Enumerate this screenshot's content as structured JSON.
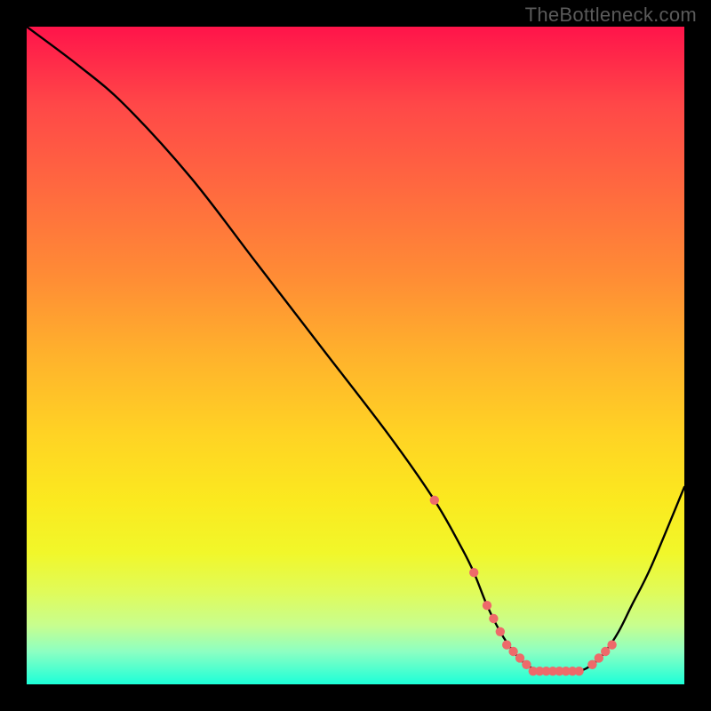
{
  "watermark": "TheBottleneck.com",
  "chart_data": {
    "type": "line",
    "title": "",
    "xlabel": "",
    "ylabel": "",
    "xlim": [
      0,
      100
    ],
    "ylim": [
      0,
      100
    ],
    "series": [
      {
        "name": "curve",
        "x": [
          0,
          8,
          15,
          25,
          35,
          45,
          55,
          62,
          66,
          68,
          70,
          72,
          74,
          76,
          78,
          80,
          82,
          84,
          86,
          88,
          90,
          92,
          95,
          100
        ],
        "y": [
          100,
          94,
          88,
          77,
          64,
          51,
          38,
          28,
          21,
          17,
          12,
          8,
          5,
          3,
          2,
          2,
          2,
          2,
          3,
          5,
          8,
          12,
          18,
          30
        ]
      }
    ],
    "markers": {
      "name": "highlight-points",
      "color": "#ee6a6a",
      "x": [
        62,
        68,
        70,
        71,
        72,
        73,
        74,
        75,
        76,
        77,
        78,
        79,
        80,
        81,
        82,
        83,
        84,
        86,
        87,
        88,
        89
      ],
      "y": [
        28,
        17,
        12,
        10,
        8,
        6,
        5,
        4,
        3,
        2,
        2,
        2,
        2,
        2,
        2,
        2,
        2,
        3,
        4,
        5,
        6
      ]
    }
  }
}
